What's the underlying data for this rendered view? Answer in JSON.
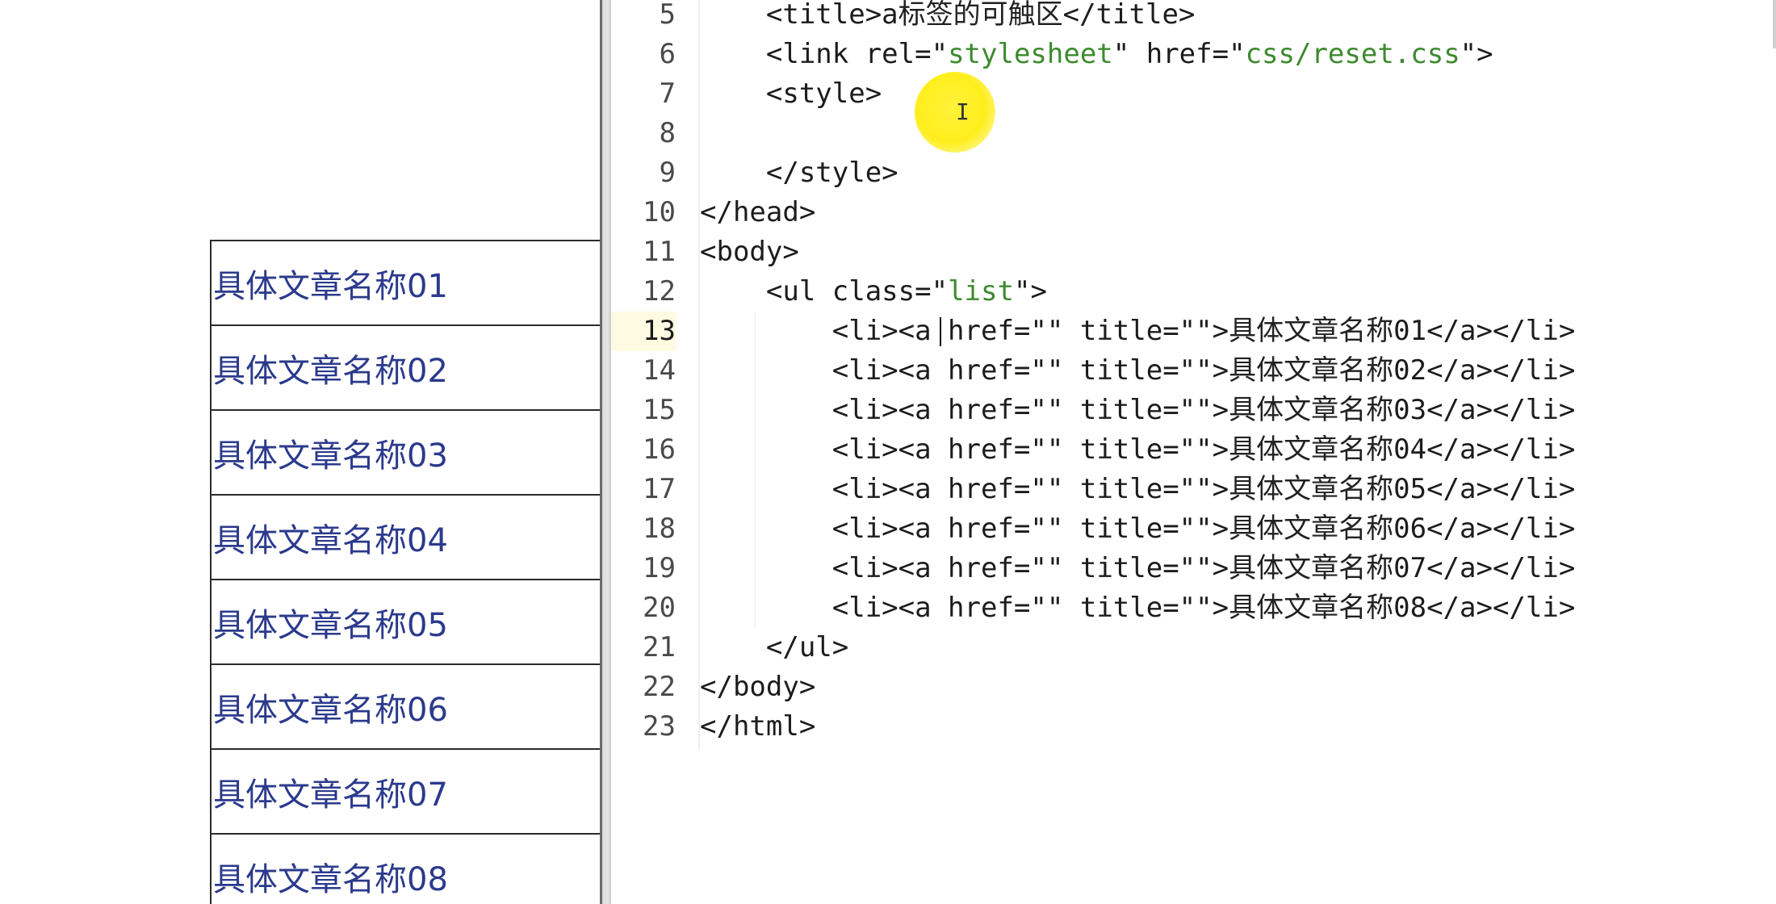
{
  "preview": {
    "list_items": [
      "具体文章名称01",
      "具体文章名称02",
      "具体文章名称03",
      "具体文章名称04",
      "具体文章名称05",
      "具体文章名称06",
      "具体文章名称07",
      "具体文章名称08"
    ]
  },
  "editor": {
    "active_line": "13",
    "lines": [
      {
        "num": "5",
        "code": "    <title>a标签的可触区</title>"
      },
      {
        "num": "6",
        "code": "    <link rel=\"stylesheet\" href=\"css/reset.css\">"
      },
      {
        "num": "7",
        "code": "    <style>"
      },
      {
        "num": "8",
        "code": ""
      },
      {
        "num": "9",
        "code": "    </style>"
      },
      {
        "num": "10",
        "code": "</head>"
      },
      {
        "num": "11",
        "code": "<body>"
      },
      {
        "num": "12",
        "code": "    <ul class=\"list\">"
      },
      {
        "num": "13",
        "code": "        <li><a href=\"\" title=\"\">具体文章名称01</a></li>"
      },
      {
        "num": "14",
        "code": "        <li><a href=\"\" title=\"\">具体文章名称02</a></li>"
      },
      {
        "num": "15",
        "code": "        <li><a href=\"\" title=\"\">具体文章名称03</a></li>"
      },
      {
        "num": "16",
        "code": "        <li><a href=\"\" title=\"\">具体文章名称04</a></li>"
      },
      {
        "num": "17",
        "code": "        <li><a href=\"\" title=\"\">具体文章名称05</a></li>"
      },
      {
        "num": "18",
        "code": "        <li><a href=\"\" title=\"\">具体文章名称06</a></li>"
      },
      {
        "num": "19",
        "code": "        <li><a href=\"\" title=\"\">具体文章名称07</a></li>"
      },
      {
        "num": "20",
        "code": "        <li><a href=\"\" title=\"\">具体文章名称08</a></li>"
      },
      {
        "num": "21",
        "code": "    </ul>"
      },
      {
        "num": "22",
        "code": "</body>"
      },
      {
        "num": "23",
        "code": "</html>"
      }
    ]
  },
  "colors": {
    "link": "#2b3a8c",
    "string": "#3c8a2e",
    "cursor_highlight": "#ffee1c"
  }
}
